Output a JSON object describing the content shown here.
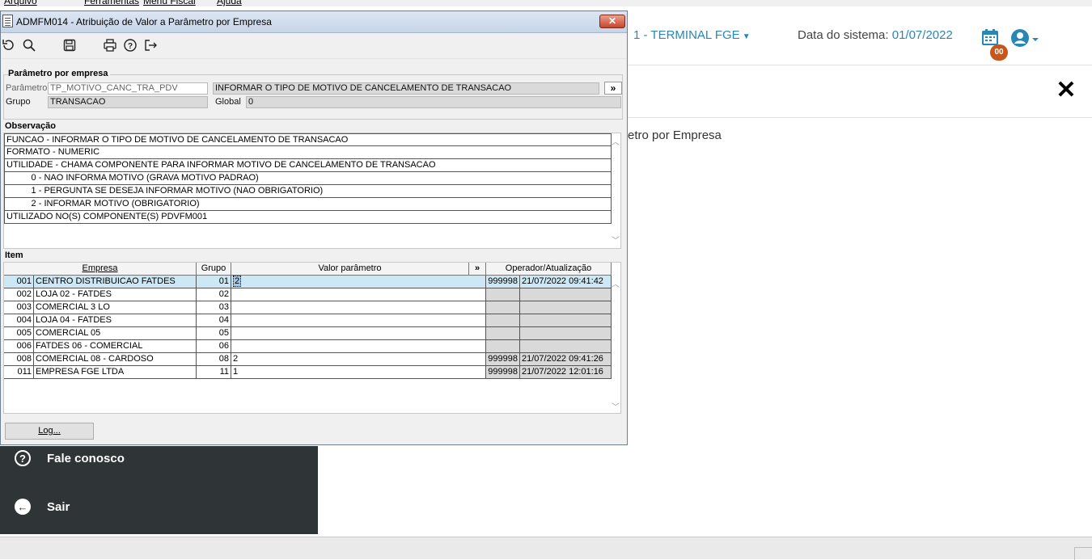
{
  "menubar": {
    "items": [
      "Arquivo",
      "Ferramentas",
      "Menu Fiscal",
      "Ajuda"
    ]
  },
  "header": {
    "terminal": "1 - TERMINAL FGE",
    "sysdate_label": "Data do sistema:",
    "sysdate_value": "01/07/2022",
    "badge": "00"
  },
  "background": {
    "page_title": "etro por Empresa"
  },
  "sidebar": {
    "items": [
      {
        "icon": "help-circle-icon",
        "label": "Fale conosco"
      },
      {
        "icon": "arrow-left-circle-icon",
        "label": "Sair"
      }
    ]
  },
  "dialog": {
    "title": "ADMFM014 - Atribuição de Valor a Parâmetro por Empresa",
    "close_label": "✕",
    "toolbar": [
      "undo-icon",
      "search-icon",
      "save-icon",
      "print-icon",
      "help-icon",
      "exit-icon"
    ],
    "param_group": {
      "title": "Parâmetro por empresa",
      "param_label": "Parâmetro",
      "param_code": "TP_MOTIVO_CANC_TRA_PDV",
      "param_desc": "INFORMAR O TIPO DE MOTIVO DE CANCELAMENTO DE TRANSACAO",
      "expand_label": "»",
      "grupo_label": "Grupo",
      "grupo_value": "TRANSACAO",
      "global_label": "Global",
      "global_value": "0"
    },
    "observacao": {
      "title": "Observação",
      "lines": [
        "FUNCAO - INFORMAR O TIPO DE MOTIVO DE CANCELAMENTO DE TRANSACAO",
        "FORMATO - NUMERIC",
        "UTILIDADE - CHAMA COMPONENTE PARA INFORMAR MOTIVO DE CANCELAMENTO DE TRANSACAO",
        "          0 - NAO INFORMA MOTIVO (GRAVA MOTIVO PADRAO)",
        "          1 - PERGUNTA SE DESEJA INFORMAR MOTIVO (NAO OBRIGATORIO)",
        "          2 - INFORMAR MOTIVO (OBRIGATORIO)",
        "UTILIZADO NO(S) COMPONENTE(S) PDVFM001"
      ]
    },
    "item": {
      "title": "Item",
      "columns": {
        "empresa": "Empresa",
        "grupo": "Grupo",
        "valor": "Valor parâmetro",
        "expand": "»",
        "operador": "Operador/Atualização"
      },
      "rows": [
        {
          "code": "001",
          "name": "CENTRO DISTRIBUICAO FATDES",
          "grupo": "01",
          "valor": "2",
          "operador": "999998",
          "data": "21/07/2022 09:41:42"
        },
        {
          "code": "002",
          "name": "LOJA 02 - FATDES",
          "grupo": "02",
          "valor": "",
          "operador": "",
          "data": ""
        },
        {
          "code": "003",
          "name": "COMERCIAL 3 LO",
          "grupo": "03",
          "valor": "",
          "operador": "",
          "data": ""
        },
        {
          "code": "004",
          "name": "LOJA 04 - FATDES",
          "grupo": "04",
          "valor": "",
          "operador": "",
          "data": ""
        },
        {
          "code": "005",
          "name": "COMERCIAL 05",
          "grupo": "05",
          "valor": "",
          "operador": "",
          "data": ""
        },
        {
          "code": "006",
          "name": "FATDES 06 - COMERCIAL",
          "grupo": "06",
          "valor": "",
          "operador": "",
          "data": ""
        },
        {
          "code": "008",
          "name": "COMERCIAL 08 - CARDOSO",
          "grupo": "08",
          "valor": "2",
          "operador": "999998",
          "data": "21/07/2022 09:41:26"
        },
        {
          "code": "011",
          "name": "EMPRESA FGE LTDA",
          "grupo": "11",
          "valor": "1",
          "operador": "999998",
          "data": "21/07/2022 12:01:16"
        }
      ]
    },
    "log_button": "Log..."
  }
}
